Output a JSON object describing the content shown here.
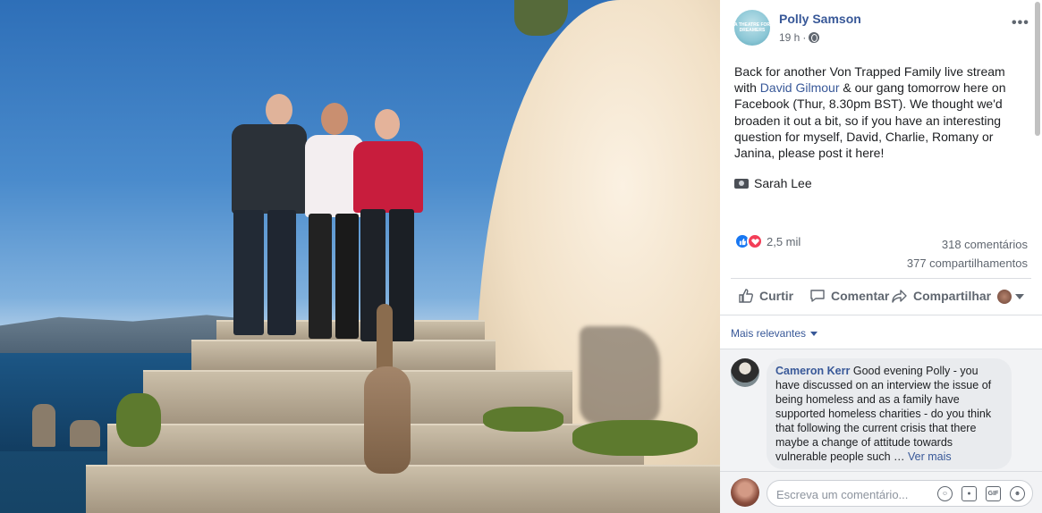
{
  "post": {
    "page_name": "Polly Samson",
    "avatar_text": "A THEATRE FOR DREAMERS",
    "time": "19 h",
    "separator": "·",
    "text_before_link": "Back for another Von Trapped Family live stream with ",
    "link_text": "David Gilmour",
    "text_after_link": " & our gang tomorrow here on Facebook (Thur, 8.30pm BST). We thought we'd broaden it out a bit, so if you have an interesting question for myself, David, Charlie, Romany or Janina, please post it here!",
    "photo_credit": "Sarah Lee"
  },
  "stats": {
    "reactions_count": "2,5 mil",
    "comments": "318 comentários",
    "shares": "377 compartilhamentos"
  },
  "actions": {
    "like": "Curtir",
    "comment": "Comentar",
    "share": "Compartilhar"
  },
  "comments": {
    "sort_label": "Mais relevantes",
    "items": [
      {
        "author": "Cameron Kerr",
        "text": " Good evening Polly - you have discussed on an interview the issue of being homeless and as a family have supported homeless charities - do you think that following the current crisis that there maybe a change of attitude towards vulnerable people such … ",
        "see_more": "Ver mais"
      }
    ]
  },
  "composer": {
    "placeholder": "Escreva um comentário..."
  },
  "icons": {
    "more": "more-options-icon",
    "globe": "globe-icon",
    "camera": "camera-icon",
    "like": "thumbs-up-icon",
    "comment": "speech-bubble-icon",
    "share": "share-arrow-icon",
    "emoji": "emoji-icon",
    "photo": "camera-icon",
    "gif": "gif-icon",
    "sticker": "sticker-icon"
  },
  "colors": {
    "link": "#385898",
    "like": "#1877f2",
    "love": "#f33e58"
  }
}
